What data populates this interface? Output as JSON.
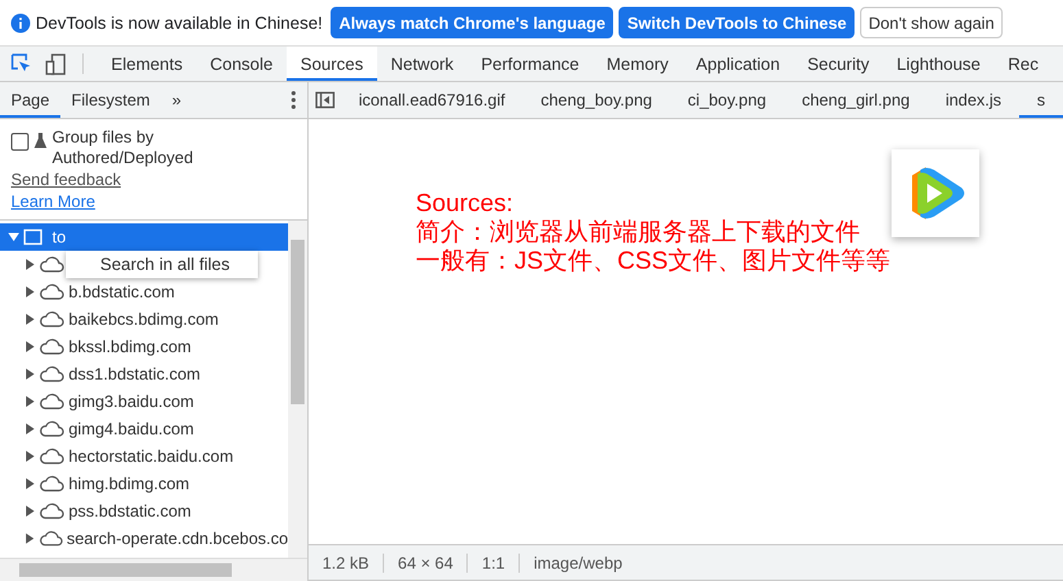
{
  "infobar": {
    "message": "DevTools is now available in Chinese!",
    "buttons": [
      {
        "label": "Always match Chrome's language",
        "kind": "primary"
      },
      {
        "label": "Switch DevTools to Chinese",
        "kind": "primary"
      },
      {
        "label": "Don't show again",
        "kind": "plain"
      }
    ]
  },
  "main_tabs": [
    {
      "label": "Elements",
      "selected": false
    },
    {
      "label": "Console",
      "selected": false
    },
    {
      "label": "Sources",
      "selected": true
    },
    {
      "label": "Network",
      "selected": false
    },
    {
      "label": "Performance",
      "selected": false
    },
    {
      "label": "Memory",
      "selected": false
    },
    {
      "label": "Application",
      "selected": false
    },
    {
      "label": "Security",
      "selected": false
    },
    {
      "label": "Lighthouse",
      "selected": false
    },
    {
      "label": "Rec",
      "selected": false
    }
  ],
  "navigator_tabs": [
    {
      "label": "Page",
      "selected": true
    },
    {
      "label": "Filesystem",
      "selected": false
    }
  ],
  "more_tabs": "»",
  "group_option": {
    "label": "Group files by Authored/Deployed",
    "checked": false
  },
  "links": [
    "Send feedback",
    "Learn More"
  ],
  "tree": {
    "root": {
      "label": "to",
      "expanded": true,
      "selected": true
    },
    "children": [
      {
        "label": "b.bdstatic.com"
      },
      {
        "label": "baikebcs.bdimg.com"
      },
      {
        "label": "bkssl.bdimg.com"
      },
      {
        "label": "dss1.bdstatic.com"
      },
      {
        "label": "gimg3.baidu.com"
      },
      {
        "label": "gimg4.baidu.com"
      },
      {
        "label": "hectorstatic.baidu.com"
      },
      {
        "label": "himg.bdimg.com"
      },
      {
        "label": "pss.bdstatic.com"
      },
      {
        "label": "search-operate.cdn.bcebos.co"
      }
    ]
  },
  "context_menu": {
    "items": [
      "Search in all files"
    ]
  },
  "file_tabs": [
    {
      "label": "iconall.ead67916.gif",
      "selected": false
    },
    {
      "label": "cheng_boy.png",
      "selected": false
    },
    {
      "label": "ci_boy.png",
      "selected": false
    },
    {
      "label": "cheng_girl.png",
      "selected": false
    },
    {
      "label": "index.js",
      "selected": false
    },
    {
      "label": "s",
      "selected": true
    }
  ],
  "annotation": [
    "Sources:",
    "简介：浏览器从前端服务器上下载的文件",
    "一般有：JS文件、CSS文件、图片文件等等"
  ],
  "status_bar": [
    "1.2 kB",
    "64 × 64",
    "1:1",
    "image/webp"
  ]
}
